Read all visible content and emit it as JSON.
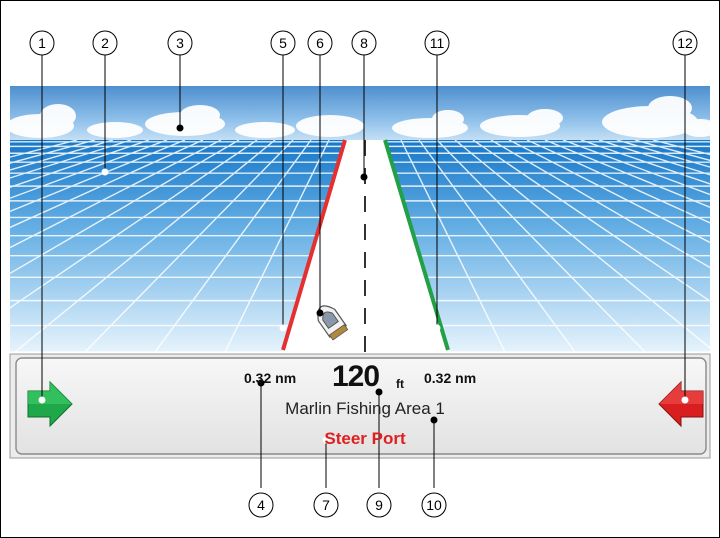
{
  "panel": {
    "xte_left": "0.32 nm",
    "distance_value": "120",
    "distance_unit": "ft",
    "xte_right": "0.32 nm",
    "waypoint_name": "Marlin Fishing Area 1",
    "steer_instruction": "Steer Port"
  },
  "callouts": {
    "c1": "1",
    "c2": "2",
    "c3": "3",
    "c4": "4",
    "c5": "5",
    "c6": "6",
    "c7": "7",
    "c8": "8",
    "c9": "9",
    "c10": "10",
    "c11": "11",
    "c12": "12"
  },
  "colors": {
    "port_line": "#e53030",
    "starboard_line": "#22a045",
    "steer_text": "#e02020",
    "left_arrow": "#1fa84a",
    "right_arrow": "#d81e1e",
    "sky": "#6aa9dc",
    "sea": "#1f86d0"
  },
  "icons": {
    "left_arrow": "green-arrow-right-icon",
    "right_arrow": "red-arrow-left-icon",
    "vessel": "boat-icon"
  }
}
